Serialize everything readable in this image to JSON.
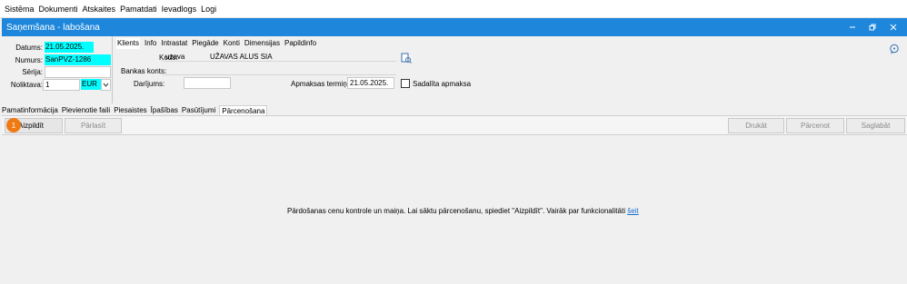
{
  "menu": {
    "items": [
      "Sistēma",
      "Dokumenti",
      "Atskaites",
      "Pamatdati",
      "Ievadlogs",
      "Logi"
    ]
  },
  "window": {
    "title": "Saņemšana - labošana",
    "min_icon": "minimize-icon",
    "restore_icon": "restore-icon",
    "close_icon": "close-icon"
  },
  "header": {
    "datums_label": "Datums:",
    "datums_value": "21.05.2025.",
    "numurs_label": "Numurs:",
    "numurs_value": "SanPVZ-1286",
    "serija_label": "Sērija:",
    "serija_value": "",
    "noliktava_label": "Noliktava:",
    "noliktava_value": "1",
    "currency_value": "EUR"
  },
  "top_tabs": [
    "Klients",
    "Info",
    "Intrastat",
    "Piegāde",
    "Konti",
    "Dimensijas",
    "Papildinfo"
  ],
  "client": {
    "kods_label": "Kods:",
    "kods_value": "uzava",
    "name_value": "UŽAVAS ALUS SIA",
    "bankas_label": "Bankas konts:",
    "darijums_label": "Darījums:",
    "termins_label": "Apmaksas termiņš:",
    "termins_value": "21.05.2025.",
    "sadalita_label": "Sadalīta apmaksa",
    "sadalita_checked": false
  },
  "mid_tabs": [
    "Pamatinformācija",
    "Pievienotie faili",
    "Piesaistes",
    "Īpašības",
    "Pasūtījumi",
    "Pārcenošana"
  ],
  "toolbar": {
    "badge": "1",
    "aizpildit": "Aizpildīt",
    "parlasit": "Pārlasīt",
    "drukat": "Drukāt",
    "parcenot": "Pārcenot",
    "saglabat": "Saglabāt"
  },
  "content": {
    "message": "Pārdošanas cenu kontrole un maiņa. Lai sāktu pārcenošanu, spiediet \"Aizpildīt\". Vairāk par funkcionalitāti",
    "link": "šeit"
  },
  "colors": {
    "titlebar": "#1e87dc",
    "highlight": "#00ffff",
    "badge": "#f07a14"
  }
}
